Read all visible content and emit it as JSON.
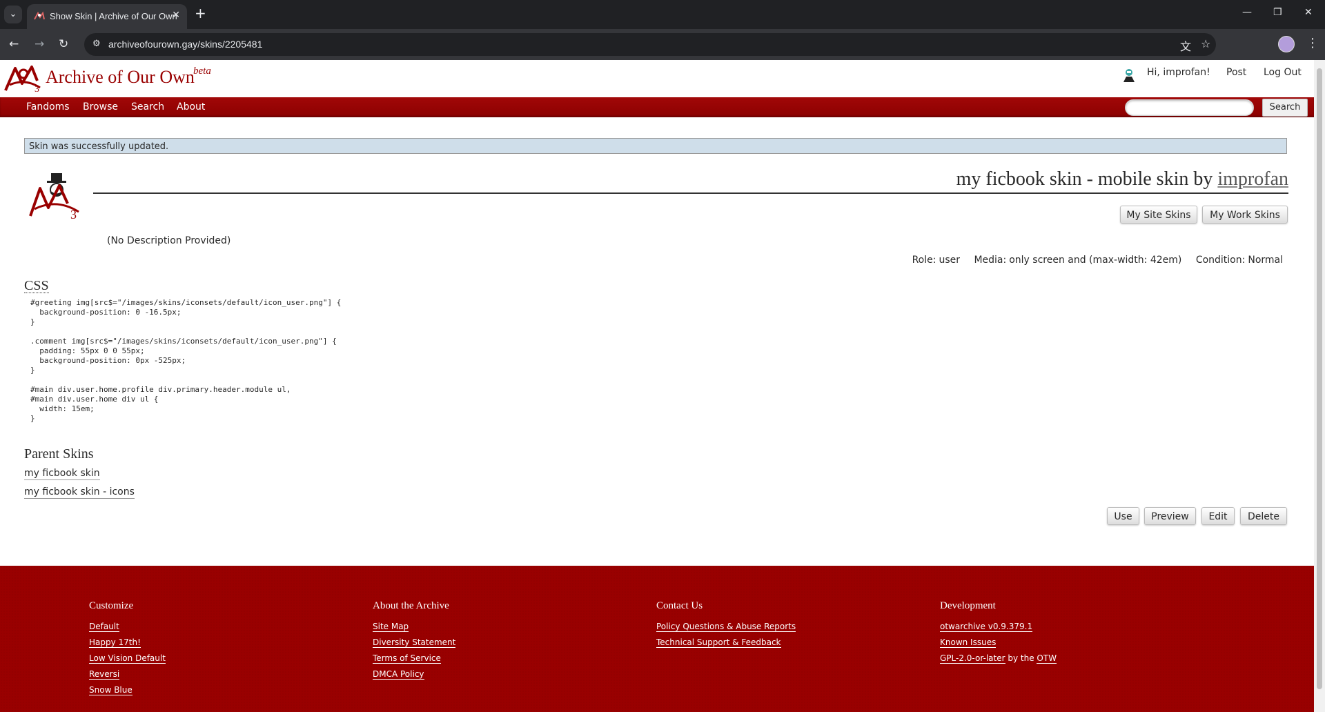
{
  "browser": {
    "tab_title": "Show Skin | Archive of Our Own",
    "url": "archiveofourown.gay/skins/2205481"
  },
  "header": {
    "site_title": "Archive of Our Own",
    "beta": "beta",
    "greeting": "Hi, improfan!",
    "post": "Post",
    "logout": "Log Out"
  },
  "nav": {
    "items": [
      "Fandoms",
      "Browse",
      "Search",
      "About"
    ],
    "search_button": "Search"
  },
  "flash": "Skin was successfully updated.",
  "skin": {
    "title": "my ficbook skin - mobile skin",
    "by": "by",
    "author": "improfan",
    "buttons": {
      "my_site_skins": "My Site Skins",
      "my_work_skins": "My Work Skins"
    },
    "description": "(No Description Provided)",
    "meta": {
      "role_label": "Role:",
      "role": "user",
      "media_label": "Media:",
      "media": "only screen and (max-width: 42em)",
      "condition_label": "Condition:",
      "condition": "Normal"
    },
    "css_heading": "CSS",
    "css": "#greeting img[src$=\"/images/skins/iconsets/default/icon_user.png\"] {\n  background-position: 0 -16.5px;\n}\n\n.comment img[src$=\"/images/skins/iconsets/default/icon_user.png\"] {\n  padding: 55px 0 0 55px;\n  background-position: 0px -525px;\n}\n\n#main div.user.home.profile div.primary.header.module ul,\n#main div.user.home div ul {\n  width: 15em;\n}",
    "parent_heading": "Parent Skins",
    "parents": [
      "my ficbook skin",
      "my ficbook skin - icons"
    ],
    "actions": {
      "use": "Use",
      "preview": "Preview",
      "edit": "Edit",
      "delete": "Delete"
    }
  },
  "footer": {
    "customize": {
      "heading": "Customize",
      "links": [
        "Default",
        "Happy 17th!",
        "Low Vision Default",
        "Reversi",
        "Snow Blue"
      ]
    },
    "about": {
      "heading": "About the Archive",
      "links": [
        "Site Map",
        "Diversity Statement",
        "Terms of Service",
        "DMCA Policy"
      ]
    },
    "contact": {
      "heading": "Contact Us",
      "links": [
        "Policy Questions & Abuse Reports",
        "Technical Support & Feedback"
      ]
    },
    "development": {
      "heading": "Development",
      "links": [
        "otwarchive v0.9.379.1",
        "Known Issues"
      ],
      "license_link": "GPL-2.0-or-later",
      "license_by": "by the",
      "otw": "OTW"
    }
  },
  "colors": {
    "brand": "#990000",
    "flash_bg": "#cfdeea",
    "chrome_dark": "#202124",
    "chrome_toolbar": "#35363a"
  },
  "icons": [
    "tab-search-icon",
    "ao3-favicon-icon",
    "close-icon",
    "new-tab-icon",
    "minimize-icon",
    "restore-icon",
    "window-close-icon",
    "back-icon",
    "forward-icon",
    "reload-icon",
    "site-info-icon",
    "translate-icon",
    "bookmark-star-icon",
    "profile-avatar-icon",
    "menu-icon",
    "ao3-logo-icon",
    "user-icon",
    "skin-preview-icon"
  ]
}
